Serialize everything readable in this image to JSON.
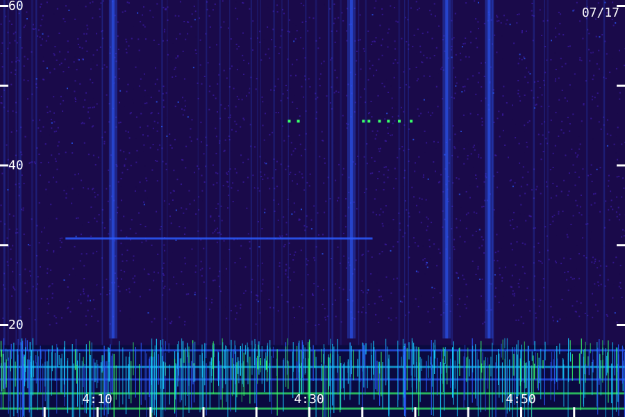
{
  "date_label": "07/17",
  "chart_data": {
    "type": "heatmap",
    "title": "",
    "xlabel": "",
    "ylabel": "",
    "y_axis": {
      "range": [
        0,
        60
      ],
      "labeled_ticks": [
        20,
        40,
        60
      ],
      "minor_ticks": [
        30,
        50
      ]
    },
    "x_axis": {
      "labeled_ticks": [
        "4:10",
        "4:30",
        "4:50"
      ]
    },
    "colormap": [
      "#1a0a4a",
      "#3a1aa0",
      "#2b5bff",
      "#18c8ff",
      "#38ff6a"
    ],
    "features": [
      {
        "kind": "horizontal_line",
        "y": 30.8,
        "x_start": "4:07",
        "x_end": "4:36"
      },
      {
        "kind": "vertical_band",
        "x": "4:11.5"
      },
      {
        "kind": "vertical_band",
        "x": "4:34"
      },
      {
        "kind": "vertical_band",
        "x": "4:43"
      },
      {
        "kind": "vertical_band",
        "x": "4:47"
      },
      {
        "kind": "dot_segment",
        "y": 45.5,
        "x_start": "4:28",
        "x_end": "4:29.5"
      },
      {
        "kind": "dot_segment",
        "y": 45.5,
        "x_start": "4:35",
        "x_end": "4:40"
      },
      {
        "kind": "noise_floor",
        "y_max": 19
      }
    ]
  }
}
